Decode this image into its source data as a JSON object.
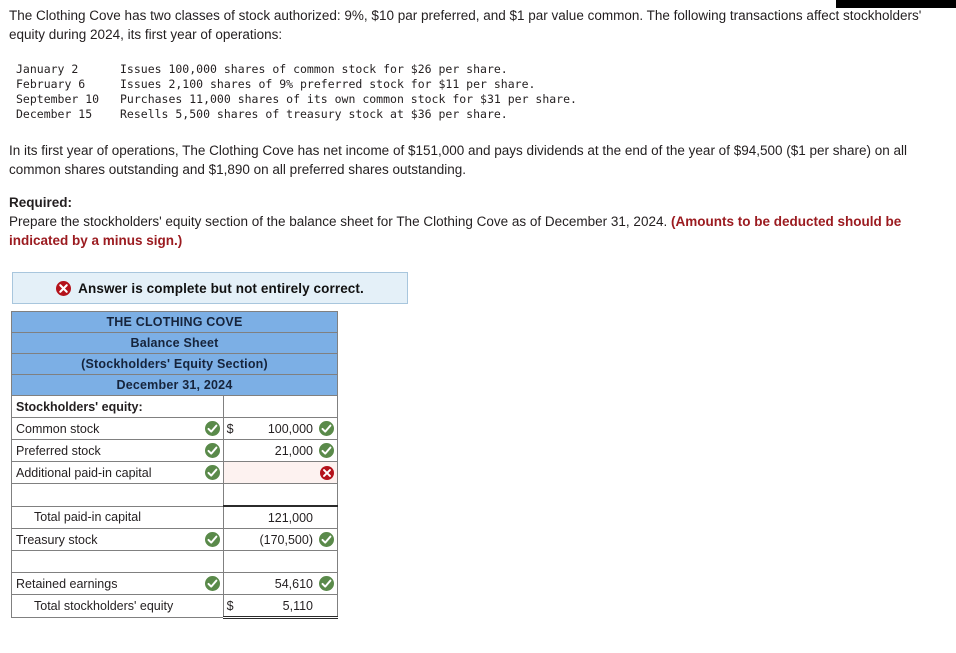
{
  "problem": {
    "intro": "The Clothing Cove has two classes of stock authorized: 9%, $10 par preferred, and $1 par value common. The following transactions affect stockholders' equity during 2024, its first year of operations:",
    "transactions": [
      {
        "date": "January 2",
        "description": "Issues 100,000 shares of common stock for $26 per share."
      },
      {
        "date": "February 6",
        "description": "Issues 2,100 shares of 9% preferred stock for $11 per share."
      },
      {
        "date": "September 10",
        "description": "Purchases 11,000 shares of its own common stock for $31 per share."
      },
      {
        "date": "December 15",
        "description": "Resells 5,500 shares of treasury stock at $36 per share."
      }
    ],
    "paragraph2": "In its first year of operations, The Clothing Cove has net income of $151,000 and pays dividends at the end of the year of $94,500 ($1 per share) on all common shares outstanding and $1,890 on all preferred shares outstanding.",
    "required_label": "Required:",
    "required_text": "Prepare the stockholders' equity section of the balance sheet for The Clothing Cove as of December 31, 2024. ",
    "required_note": "(Amounts to be deducted should be indicated by a minus sign.)"
  },
  "banner": {
    "text": "Answer is complete but not entirely correct.",
    "icon": "x-circle-icon"
  },
  "balance_sheet": {
    "headers": [
      "THE CLOTHING COVE",
      "Balance Sheet",
      "(Stockholders' Equity Section)",
      "December 31, 2024"
    ],
    "rows": [
      {
        "label": "Stockholders' equity:",
        "style": "bold",
        "indent": 0,
        "label_icon": "",
        "dollar": "",
        "value": "",
        "value_icon": "",
        "cell_state": "normal",
        "line": "none"
      },
      {
        "label": "Common stock",
        "style": "normal",
        "indent": 0,
        "label_icon": "check-icon",
        "dollar": "$",
        "value": "100,000",
        "value_icon": "check-icon",
        "cell_state": "normal",
        "line": "none"
      },
      {
        "label": "Preferred stock",
        "style": "normal",
        "indent": 0,
        "label_icon": "check-icon",
        "dollar": "",
        "value": "21,000",
        "value_icon": "check-icon",
        "cell_state": "normal",
        "line": "none"
      },
      {
        "label": "Additional paid-in capital",
        "style": "normal",
        "indent": 0,
        "label_icon": "check-icon",
        "dollar": "",
        "value": "",
        "value_icon": "x-icon",
        "cell_state": "wrong",
        "line": "none"
      },
      {
        "label": "",
        "style": "normal",
        "indent": 0,
        "label_icon": "",
        "dollar": "",
        "value": "",
        "value_icon": "",
        "cell_state": "normal",
        "line": "none"
      },
      {
        "label": "Total paid-in capital",
        "style": "normal",
        "indent": 1,
        "label_icon": "",
        "dollar": "",
        "value": "121,000",
        "value_icon": "",
        "cell_state": "normal",
        "line": "subtotal"
      },
      {
        "label": "Treasury stock",
        "style": "normal",
        "indent": 0,
        "label_icon": "check-icon",
        "dollar": "",
        "value": "(170,500)",
        "value_icon": "check-icon",
        "cell_state": "normal",
        "line": "none"
      },
      {
        "label": "",
        "style": "normal",
        "indent": 0,
        "label_icon": "",
        "dollar": "",
        "value": "",
        "value_icon": "",
        "cell_state": "normal",
        "line": "none"
      },
      {
        "label": "Retained earnings",
        "style": "normal",
        "indent": 0,
        "label_icon": "check-icon",
        "dollar": "",
        "value": "54,610",
        "value_icon": "check-icon",
        "cell_state": "normal",
        "line": "none"
      },
      {
        "label": "Total stockholders' equity",
        "style": "normal",
        "indent": 1,
        "label_icon": "",
        "dollar": "$",
        "value": "5,110",
        "value_icon": "",
        "cell_state": "normal",
        "line": "grand"
      }
    ]
  },
  "colors": {
    "header_blue": "#7cafe5",
    "banner_bg": "#e4f0f8",
    "banner_border": "#a8c6dd",
    "check_green": "#5a8a4a",
    "x_red": "#b4121b",
    "note_red": "#9b1b20",
    "wrong_cell_bg": "#fdf2f0"
  }
}
